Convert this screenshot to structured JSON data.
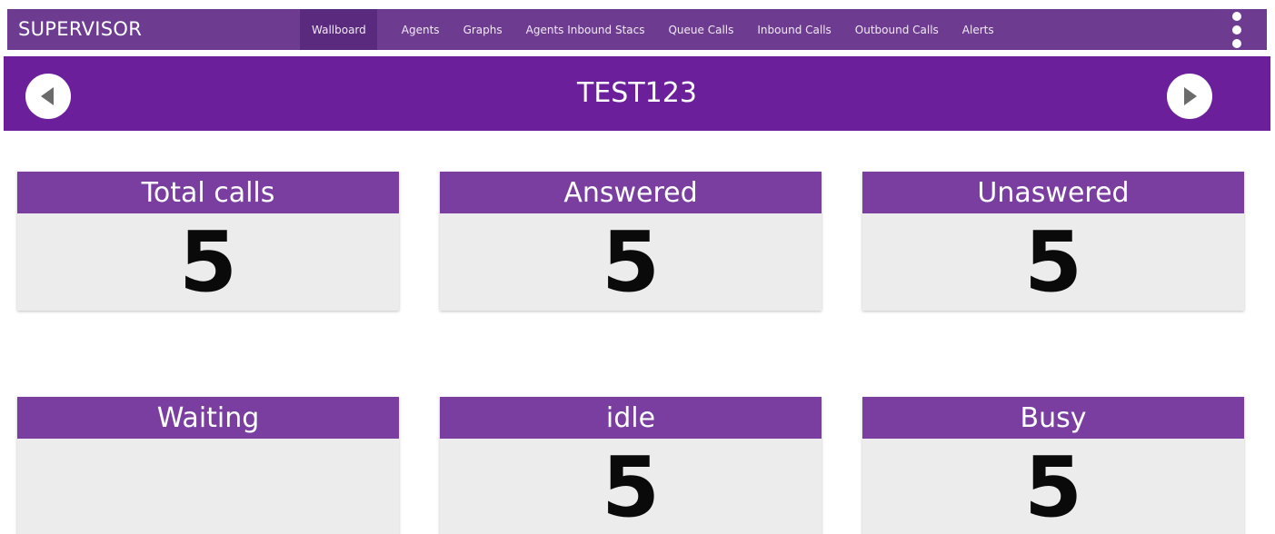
{
  "header": {
    "brand": "SUPERVISOR",
    "nav": [
      {
        "label": "Wallboard",
        "active": true
      },
      {
        "label": "Agents",
        "active": false
      },
      {
        "label": "Graphs",
        "active": false
      },
      {
        "label": "Agents Inbound Stacs",
        "active": false
      },
      {
        "label": "Queue Calls",
        "active": false
      },
      {
        "label": "Inbound Calls",
        "active": false
      },
      {
        "label": "Outbound Calls",
        "active": false
      },
      {
        "label": "Alerts",
        "active": false
      }
    ],
    "menu_icon": "kebab-menu-icon"
  },
  "wallboard": {
    "title": "TEST123",
    "prev_icon": "chevron-left-icon",
    "next_icon": "chevron-right-icon"
  },
  "stats": [
    {
      "label": "Total calls",
      "value": "5"
    },
    {
      "label": "Answered",
      "value": "5"
    },
    {
      "label": "Unaswered",
      "value": "5"
    },
    {
      "label": "Waiting",
      "value": ""
    },
    {
      "label": "idle",
      "value": "5"
    },
    {
      "label": "Busy",
      "value": "5"
    }
  ],
  "colors": {
    "nav_bg": "#6d3c90",
    "nav_active": "#5a2a7e",
    "title_bg": "#6b1f9a",
    "card_header": "#793ea0",
    "card_body": "#ececec"
  }
}
